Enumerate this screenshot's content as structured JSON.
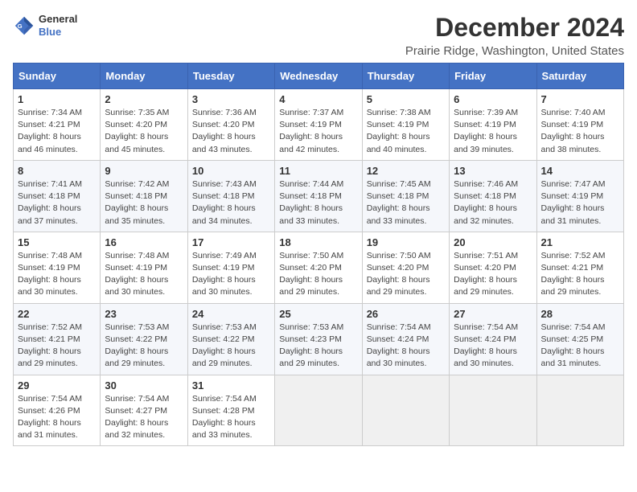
{
  "header": {
    "logo_line1": "General",
    "logo_line2": "Blue",
    "month_title": "December 2024",
    "location": "Prairie Ridge, Washington, United States"
  },
  "days_of_week": [
    "Sunday",
    "Monday",
    "Tuesday",
    "Wednesday",
    "Thursday",
    "Friday",
    "Saturday"
  ],
  "weeks": [
    [
      {
        "day": "1",
        "sunrise": "7:34 AM",
        "sunset": "4:21 PM",
        "daylight": "8 hours and 46 minutes."
      },
      {
        "day": "2",
        "sunrise": "7:35 AM",
        "sunset": "4:20 PM",
        "daylight": "8 hours and 45 minutes."
      },
      {
        "day": "3",
        "sunrise": "7:36 AM",
        "sunset": "4:20 PM",
        "daylight": "8 hours and 43 minutes."
      },
      {
        "day": "4",
        "sunrise": "7:37 AM",
        "sunset": "4:19 PM",
        "daylight": "8 hours and 42 minutes."
      },
      {
        "day": "5",
        "sunrise": "7:38 AM",
        "sunset": "4:19 PM",
        "daylight": "8 hours and 40 minutes."
      },
      {
        "day": "6",
        "sunrise": "7:39 AM",
        "sunset": "4:19 PM",
        "daylight": "8 hours and 39 minutes."
      },
      {
        "day": "7",
        "sunrise": "7:40 AM",
        "sunset": "4:19 PM",
        "daylight": "8 hours and 38 minutes."
      }
    ],
    [
      {
        "day": "8",
        "sunrise": "7:41 AM",
        "sunset": "4:18 PM",
        "daylight": "8 hours and 37 minutes."
      },
      {
        "day": "9",
        "sunrise": "7:42 AM",
        "sunset": "4:18 PM",
        "daylight": "8 hours and 35 minutes."
      },
      {
        "day": "10",
        "sunrise": "7:43 AM",
        "sunset": "4:18 PM",
        "daylight": "8 hours and 34 minutes."
      },
      {
        "day": "11",
        "sunrise": "7:44 AM",
        "sunset": "4:18 PM",
        "daylight": "8 hours and 33 minutes."
      },
      {
        "day": "12",
        "sunrise": "7:45 AM",
        "sunset": "4:18 PM",
        "daylight": "8 hours and 33 minutes."
      },
      {
        "day": "13",
        "sunrise": "7:46 AM",
        "sunset": "4:18 PM",
        "daylight": "8 hours and 32 minutes."
      },
      {
        "day": "14",
        "sunrise": "7:47 AM",
        "sunset": "4:19 PM",
        "daylight": "8 hours and 31 minutes."
      }
    ],
    [
      {
        "day": "15",
        "sunrise": "7:48 AM",
        "sunset": "4:19 PM",
        "daylight": "8 hours and 30 minutes."
      },
      {
        "day": "16",
        "sunrise": "7:48 AM",
        "sunset": "4:19 PM",
        "daylight": "8 hours and 30 minutes."
      },
      {
        "day": "17",
        "sunrise": "7:49 AM",
        "sunset": "4:19 PM",
        "daylight": "8 hours and 30 minutes."
      },
      {
        "day": "18",
        "sunrise": "7:50 AM",
        "sunset": "4:20 PM",
        "daylight": "8 hours and 29 minutes."
      },
      {
        "day": "19",
        "sunrise": "7:50 AM",
        "sunset": "4:20 PM",
        "daylight": "8 hours and 29 minutes."
      },
      {
        "day": "20",
        "sunrise": "7:51 AM",
        "sunset": "4:20 PM",
        "daylight": "8 hours and 29 minutes."
      },
      {
        "day": "21",
        "sunrise": "7:52 AM",
        "sunset": "4:21 PM",
        "daylight": "8 hours and 29 minutes."
      }
    ],
    [
      {
        "day": "22",
        "sunrise": "7:52 AM",
        "sunset": "4:21 PM",
        "daylight": "8 hours and 29 minutes."
      },
      {
        "day": "23",
        "sunrise": "7:53 AM",
        "sunset": "4:22 PM",
        "daylight": "8 hours and 29 minutes."
      },
      {
        "day": "24",
        "sunrise": "7:53 AM",
        "sunset": "4:22 PM",
        "daylight": "8 hours and 29 minutes."
      },
      {
        "day": "25",
        "sunrise": "7:53 AM",
        "sunset": "4:23 PM",
        "daylight": "8 hours and 29 minutes."
      },
      {
        "day": "26",
        "sunrise": "7:54 AM",
        "sunset": "4:24 PM",
        "daylight": "8 hours and 30 minutes."
      },
      {
        "day": "27",
        "sunrise": "7:54 AM",
        "sunset": "4:24 PM",
        "daylight": "8 hours and 30 minutes."
      },
      {
        "day": "28",
        "sunrise": "7:54 AM",
        "sunset": "4:25 PM",
        "daylight": "8 hours and 31 minutes."
      }
    ],
    [
      {
        "day": "29",
        "sunrise": "7:54 AM",
        "sunset": "4:26 PM",
        "daylight": "8 hours and 31 minutes."
      },
      {
        "day": "30",
        "sunrise": "7:54 AM",
        "sunset": "4:27 PM",
        "daylight": "8 hours and 32 minutes."
      },
      {
        "day": "31",
        "sunrise": "7:54 AM",
        "sunset": "4:28 PM",
        "daylight": "8 hours and 33 minutes."
      },
      null,
      null,
      null,
      null
    ]
  ],
  "labels": {
    "sunrise": "Sunrise:",
    "sunset": "Sunset:",
    "daylight": "Daylight:"
  }
}
